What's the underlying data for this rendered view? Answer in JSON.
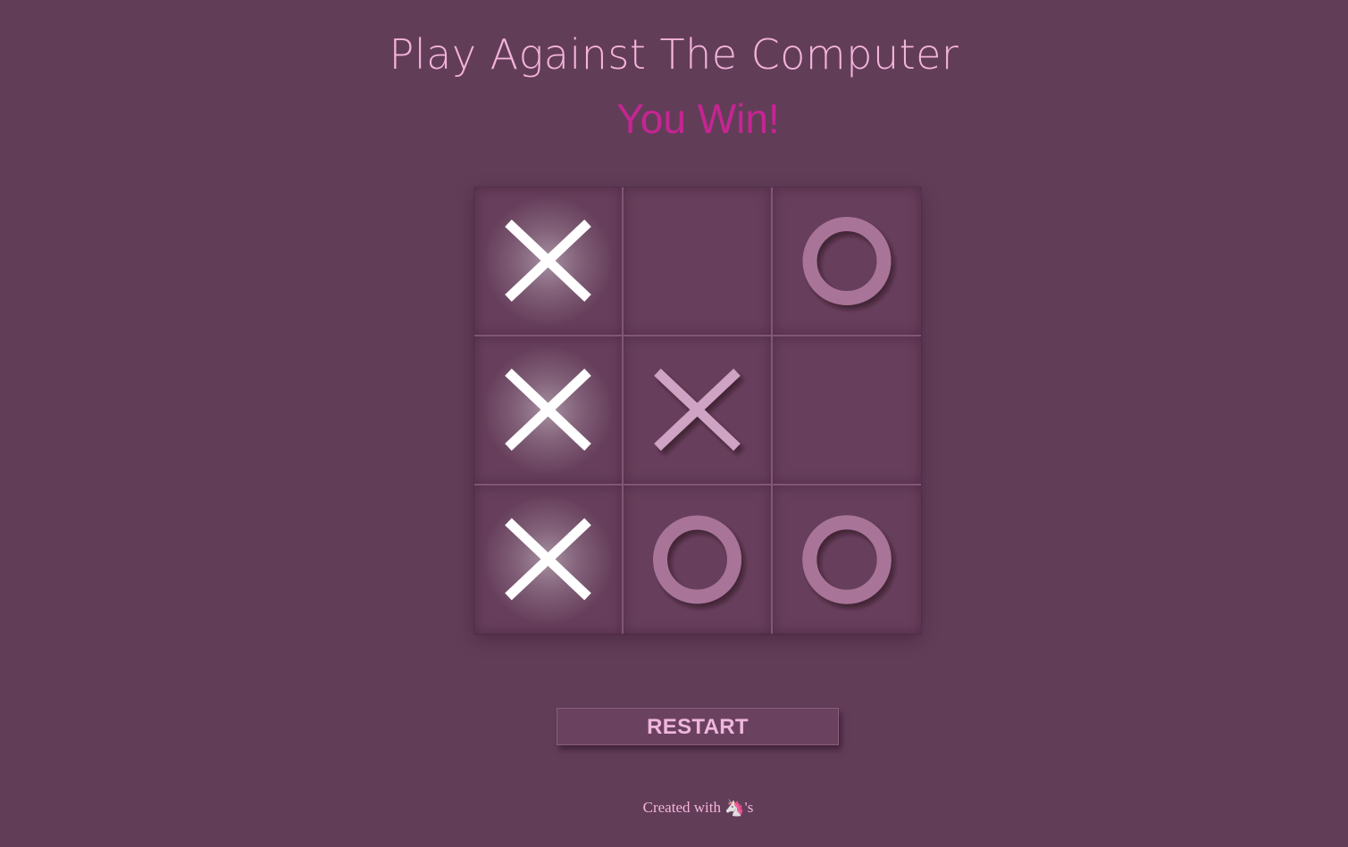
{
  "header": {
    "title": "Play Against The Computer",
    "status": "You Win!"
  },
  "board": {
    "cells": [
      "X",
      "",
      "O",
      "X",
      "X",
      "",
      "X",
      "O",
      "O"
    ],
    "winning_cells": [
      0,
      3,
      6
    ]
  },
  "controls": {
    "restart_label": "RESTART"
  },
  "footer": {
    "text_before": "Created with",
    "icon": "unicorn-icon",
    "icon_glyph": "🦄",
    "text_after": "'s"
  },
  "colors": {
    "background": "#623d58",
    "title": "#f4b4dc",
    "status": "#c52592",
    "x_win": "#ffffff",
    "x_normal": "#cfa3c3",
    "o_mark": "#a87598"
  }
}
